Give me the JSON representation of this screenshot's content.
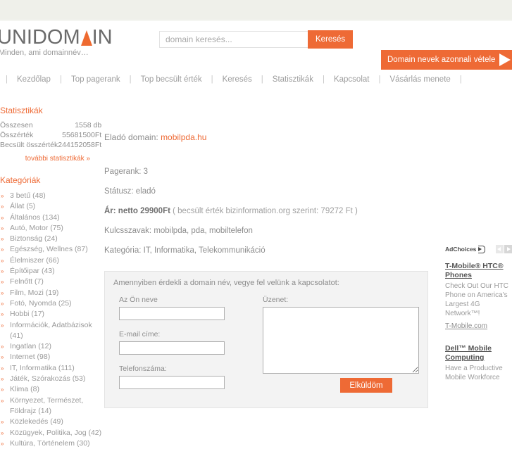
{
  "colors": {
    "accent": "#ee6a35",
    "top_band": "#eff0ea",
    "text": "#8c8c8c",
    "form_bg": "#f3f3f3"
  },
  "header": {
    "logo_part1": "UNIDOM",
    "logo_part2": "IN",
    "tagline": "Minden, ami domainnév…",
    "search_placeholder": "domain keresés...",
    "search_value": "",
    "search_button": "Keresés",
    "cta_label": "Domain nevek azonnali vétele"
  },
  "nav": {
    "items": [
      "Kezdőlap",
      "Top pagerank",
      "Top becsült érték",
      "Keresés",
      "Statisztikák",
      "Kapcsolat",
      "Vásárlás menete"
    ]
  },
  "sidebar": {
    "stats_heading": "Statisztikák",
    "stats": [
      {
        "label": "Összesen",
        "value": "1558 db"
      },
      {
        "label": "Összérték",
        "value": "55681500Ft"
      },
      {
        "label": "Becsült összérték",
        "value": "244152058Ft"
      }
    ],
    "stats_more": "további statisztikák »",
    "categories_heading": "Kategóriák",
    "categories": [
      "3 betű (48)",
      "Állat (5)",
      "Általános (134)",
      "Autó, Motor (75)",
      "Biztonság (24)",
      "Egészség, Wellnes (87)",
      "Élelmiszer (66)",
      "Építőipar (43)",
      "Felnőtt (7)",
      "Film, Mozi (19)",
      "Fotó, Nyomda (25)",
      "Hobbi (17)",
      "Információk, Adatbázisok (41)",
      "Ingatlan (12)",
      "Internet (98)",
      "IT, Informatika (111)",
      "Játék, Szórakozás (53)",
      "Klima (8)",
      "Környezet, Természet, Földrajz (14)",
      "Közlekedés (49)",
      "Közügyek, Politika, Jog (42)",
      "Kultúra, Történelem (30)"
    ]
  },
  "main": {
    "domain_label": "Eladó domain:",
    "domain_name": "mobilpda.hu",
    "pagerank_label": "Pagerank:",
    "pagerank_value": "3",
    "status_label": "Státusz:",
    "status_value": "eladó",
    "price_label": "Ár: netto 29900Ft",
    "price_note": "( becsült érték bizinformation.org szerint: 79272 Ft )",
    "keywords_label": "Kulcsszavak:",
    "keywords_value": "mobilpda, pda, mobiltelefon",
    "category_label": "Kategória:",
    "category_value": "IT, Informatika, Telekommunikáció"
  },
  "contact": {
    "intro": "Amennyiben érdekli a domain név, vegye fel velünk a kapcsolatot:",
    "name_label": "Az Ön neve",
    "name_value": "",
    "email_label": "E-mail címe:",
    "email_value": "",
    "phone_label": "Telefonszáma:",
    "phone_value": "",
    "message_label": "Üzenet:",
    "message_value": "",
    "submit_label": "Elküldöm"
  },
  "ads": {
    "adchoices_label": "AdChoices",
    "blocks": [
      {
        "title": "T-Mobile® HTC® Phones",
        "body": "Check Out Our HTC Phone on America's Largest 4G Network™!",
        "url": "T-Mobile.com"
      },
      {
        "title": "Dell™ Mobile Computing",
        "body": "Have a Productive Mobile Workforce",
        "url": ""
      }
    ]
  }
}
